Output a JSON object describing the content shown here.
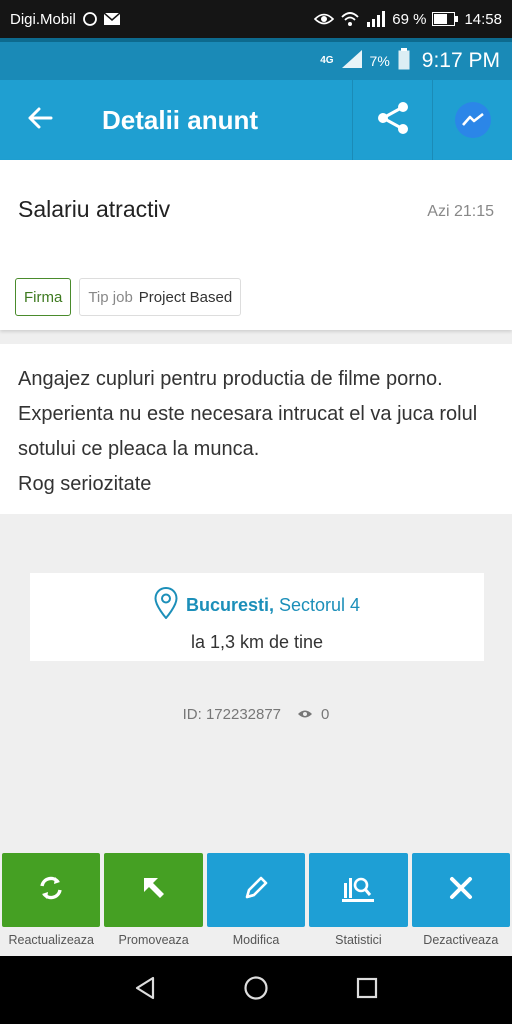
{
  "system_bar": {
    "carrier": "Digi.Mobil",
    "battery": "69 %",
    "time": "14:58"
  },
  "app_status": {
    "network": "4G",
    "battery": "7%",
    "time": "9:17 PM"
  },
  "header": {
    "title": "Detalii anunt"
  },
  "ad": {
    "title": "Salariu atractiv",
    "time": "Azi 21:15",
    "tags": {
      "firma": "Firma",
      "job_type_label": "Tip job",
      "job_type_value": "Project Based"
    }
  },
  "description": [
    "Angajez cupluri pentru productia de filme porno. Experienta nu este necesara intrucat el va juca rolul sotului ce pleaca la munca.",
    "Rog seriozitate"
  ],
  "location": {
    "city": "Bucuresti,",
    "area": "Sectorul 4",
    "distance": "la 1,3 km de tine"
  },
  "meta": {
    "id": "ID: 172232877",
    "views": "0"
  },
  "actions": [
    {
      "label": "Reactualizeaza",
      "color": "#45a023",
      "icon": "refresh-icon"
    },
    {
      "label": "Promoveaza",
      "color": "#45a023",
      "icon": "cursor-arrow-icon"
    },
    {
      "label": "Modifica",
      "color": "#1e9fd5",
      "icon": "pencil-icon"
    },
    {
      "label": "Statistici",
      "color": "#1e9fd5",
      "icon": "stats-icon"
    },
    {
      "label": "Dezactiveaza",
      "color": "#1e9fd5",
      "icon": "close-icon"
    }
  ]
}
